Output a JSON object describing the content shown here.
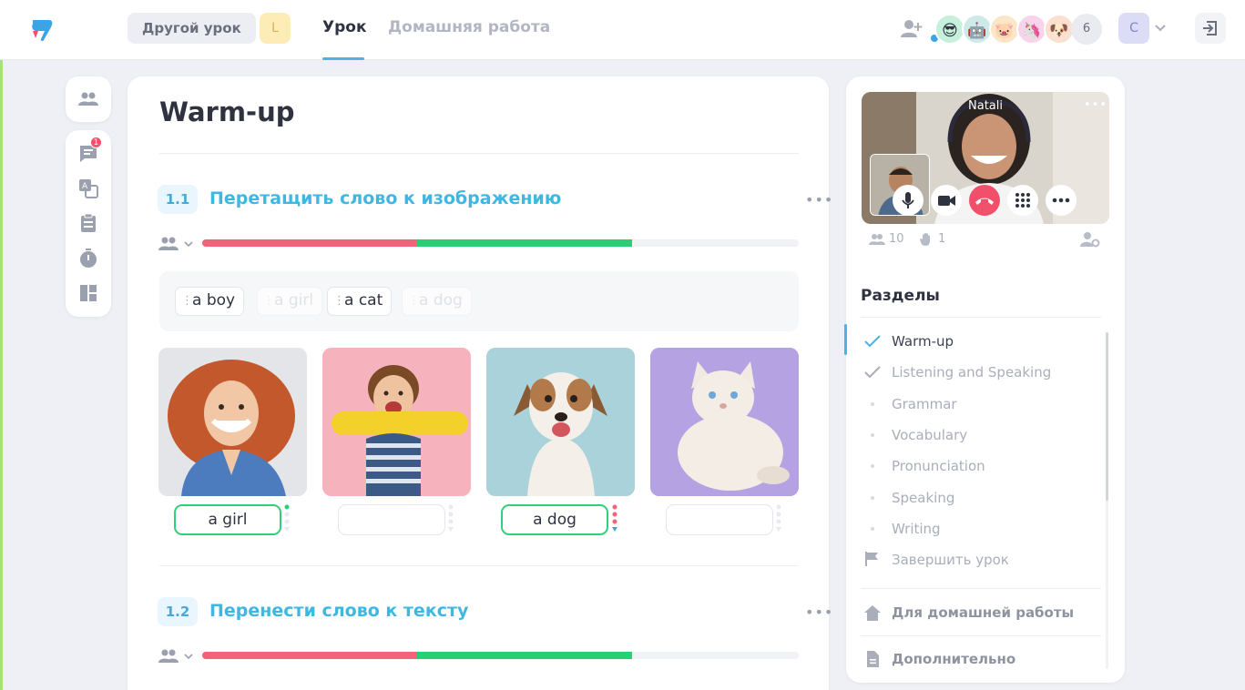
{
  "header": {
    "other_lesson_label": "Другой урок",
    "level_badge": "L",
    "tabs": [
      {
        "label": "Урок",
        "active": true
      },
      {
        "label": "Домашняя работа",
        "active": false
      }
    ],
    "participant_avatars": [
      "😎",
      "🤖",
      "🐷",
      "🦄",
      "🐶"
    ],
    "participant_count": "6",
    "user_initial": "C",
    "accent_color": "#4bb3e6"
  },
  "toolbar": {
    "chat_notifications": "1",
    "icons": [
      "users-icon",
      "chat-icon",
      "translate-icon",
      "clipboard-icon",
      "timer-icon",
      "layout-icon"
    ]
  },
  "lesson": {
    "title": "Warm-up",
    "sections": [
      {
        "number": "1.1",
        "title": "Перетащить слово к изображению",
        "progress": {
          "red_fraction": 0.36,
          "green_fraction": 0.36
        },
        "word_bank": [
          {
            "text": "a boy",
            "used": false
          },
          {
            "text": "a girl",
            "used": true
          },
          {
            "text": "a cat",
            "used": false
          },
          {
            "text": "a dog",
            "used": true
          }
        ],
        "images": [
          {
            "subject": "girl",
            "answer": "a girl",
            "correct": true
          },
          {
            "subject": "boy",
            "answer": "",
            "correct": false
          },
          {
            "subject": "dog",
            "answer": "a dog",
            "correct": true
          },
          {
            "subject": "cat",
            "answer": "",
            "correct": false
          }
        ]
      },
      {
        "number": "1.2",
        "title": "Перенести слово к тексту",
        "progress": {
          "red_fraction": 0.36,
          "green_fraction": 0.36
        }
      }
    ],
    "colors": {
      "progress_red": "#f3627a",
      "progress_green": "#29cf74",
      "section_title": "#3fb7e3"
    }
  },
  "video": {
    "presenter_name": "Natali",
    "more_label": "•••",
    "participants": "10",
    "hands": "1"
  },
  "sidebar": {
    "title": "Разделы",
    "items": [
      {
        "label": "Warm-up",
        "state": "done"
      },
      {
        "label": "Listening and Speaking",
        "state": "done-muted"
      },
      {
        "label": "Grammar",
        "state": "todo"
      },
      {
        "label": "Vocabulary",
        "state": "todo"
      },
      {
        "label": "Pronunciation",
        "state": "todo"
      },
      {
        "label": "Speaking",
        "state": "todo"
      },
      {
        "label": "Writing",
        "state": "todo"
      }
    ],
    "finish_label": "Завершить урок",
    "homework_label": "Для домашней работы",
    "extra_label": "Дополнительно"
  }
}
